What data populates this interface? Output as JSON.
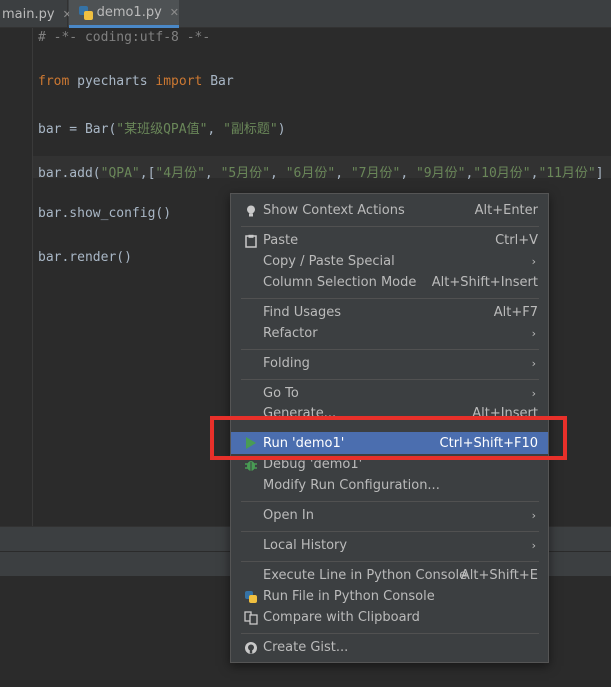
{
  "tabs": [
    {
      "label": "main.py",
      "close": "✕"
    },
    {
      "label": "demo1.py",
      "close": "✕"
    }
  ],
  "code_lines": {
    "l1": "# -*- coding:utf-8 -*-",
    "l3_kw1": "from",
    "l3_mod": " pyecharts ",
    "l3_kw2": "import",
    "l3_name": " Bar",
    "l5_a": "bar = Bar(",
    "l5_s1": "\"某班级QPA值\"",
    "l5_b": ", ",
    "l5_s2": "\"副标题\"",
    "l5_c": ")",
    "l7_a": "bar.add(",
    "l7_s1": "\"QPA\"",
    "l7_b": ",[",
    "l7_s2": "\"4月份\"",
    "l7_c": ", ",
    "l7_s3": "\"5月份\"",
    "l7_d": ", ",
    "l7_s4": "\"6月份\"",
    "l7_e": ", ",
    "l7_s5": "\"7月份\"",
    "l7_f": ", ",
    "l7_s6": "\"9月份\"",
    "l7_g": ",",
    "l7_s7": "\"10月份\"",
    "l7_h": ",",
    "l7_s8": "\"11月份\"",
    "l7_i": "]",
    "l9": "bar.show_config()",
    "l11": "bar.render()"
  },
  "menu": {
    "items": {
      "show_context_actions": {
        "label": "Show Context Actions",
        "shortcut": "Alt+Enter",
        "icon": "bulb-icon"
      },
      "paste": {
        "label": "Paste",
        "shortcut": "Ctrl+V",
        "icon": "clipboard-icon"
      },
      "copy_paste_special": {
        "label": "Copy / Paste Special"
      },
      "column_selection_mode": {
        "label": "Column Selection Mode",
        "shortcut": "Alt+Shift+Insert"
      },
      "find_usages": {
        "label": "Find Usages",
        "shortcut": "Alt+F7"
      },
      "refactor": {
        "label": "Refactor"
      },
      "folding": {
        "label": "Folding"
      },
      "go_to": {
        "label": "Go To"
      },
      "generate": {
        "label": "Generate...",
        "shortcut": "Alt+Insert"
      },
      "run": {
        "label": "Run 'demo1'",
        "shortcut": "Ctrl+Shift+F10",
        "icon": "run-triangle-icon"
      },
      "debug": {
        "label": "Debug 'demo1'",
        "icon": "bug-icon"
      },
      "modify_run": {
        "label": "Modify Run Configuration..."
      },
      "open_in": {
        "label": "Open In"
      },
      "local_history": {
        "label": "Local History"
      },
      "execute_line": {
        "label": "Execute Line in Python Console",
        "shortcut": "Alt+Shift+E"
      },
      "run_file_console": {
        "label": "Run File in Python Console",
        "icon": "python-icon"
      },
      "compare_clipboard": {
        "label": "Compare with Clipboard",
        "icon": "compare-icon"
      },
      "create_gist": {
        "label": "Create Gist...",
        "icon": "github-icon"
      }
    },
    "arrow": "›"
  },
  "colors": {
    "selection": "#4b6eaf",
    "highlight_box": "#e8302a",
    "run_green": "#499c54"
  }
}
